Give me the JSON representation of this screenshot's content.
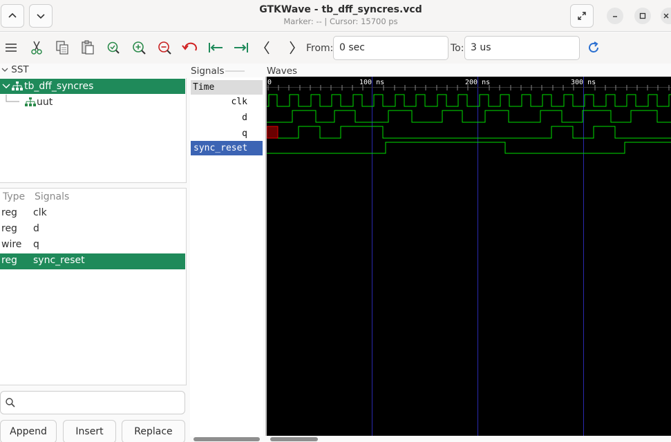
{
  "window": {
    "title": "GTKWave - tb_dff_syncres.vcd",
    "subtitle": "Marker: --  |  Cursor: 15700 ps"
  },
  "toolbar": {
    "from_label": "From:",
    "from_value": "0 sec",
    "to_label": "To:",
    "to_value": "3 us"
  },
  "sst": {
    "header": "SST",
    "tree": [
      {
        "label": "tb_dff_syncres",
        "selected": true
      },
      {
        "label": "uut",
        "selected": false
      }
    ]
  },
  "signal_list": {
    "col_type": "Type",
    "col_signals": "Signals",
    "rows": [
      {
        "type": "reg",
        "name": "clk",
        "selected": false
      },
      {
        "type": "reg",
        "name": "d",
        "selected": false
      },
      {
        "type": "wire",
        "name": "q",
        "selected": false
      },
      {
        "type": "reg",
        "name": "sync_reset",
        "selected": true
      }
    ]
  },
  "search": {
    "placeholder": ""
  },
  "buttons": {
    "append": "Append",
    "insert": "Insert",
    "replace": "Replace"
  },
  "signals_panel": {
    "header": "Signals",
    "time_row": "Time",
    "rows": [
      "clk",
      "d",
      "q",
      "sync_reset"
    ]
  },
  "waves_panel": {
    "header": "Waves",
    "time_ticks": [
      "0",
      "100 ns",
      "200 ns",
      "300 ns"
    ],
    "colors": {
      "wave": "#00e000",
      "grid": "#2a2ab0",
      "text": "#ffffff",
      "x_state": "#e00000"
    }
  }
}
